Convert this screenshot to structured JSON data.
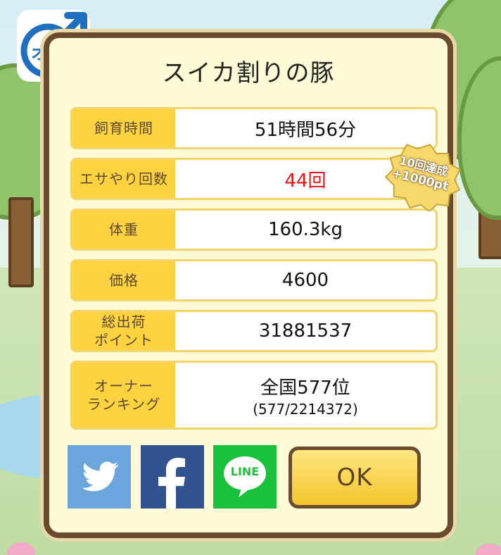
{
  "badge": {
    "sex_label": "オス",
    "icon": "male-symbol-icon",
    "color": "#1f6fc0"
  },
  "title": "スイカ割りの豚",
  "stats": [
    {
      "label": "飼育時間",
      "value": "51時間56分"
    },
    {
      "label": "エサやり回数",
      "value": "44回",
      "value_color": "#e8141b"
    },
    {
      "label": "体重",
      "value": "160.3kg"
    },
    {
      "label": "価格",
      "value": "4600"
    },
    {
      "label": "総出荷\nポイント",
      "value": "31881537"
    },
    {
      "label": "オーナー\nランキング",
      "value": "全国577位",
      "sub_value": "(577/2214372)"
    }
  ],
  "achievement": {
    "line1": "10回達成",
    "line2": "+1000pt"
  },
  "share": {
    "twitter_icon": "twitter-bird-icon",
    "facebook_icon": "facebook-f-icon",
    "line_icon": "line-icon",
    "line_label": "LINE"
  },
  "ok_label": "OK",
  "colors": {
    "label_bg": "#ffd23f",
    "panel_bg": "#fffbd7",
    "frame": "#6b4b2e",
    "ok_bg": "#f3c52c"
  }
}
